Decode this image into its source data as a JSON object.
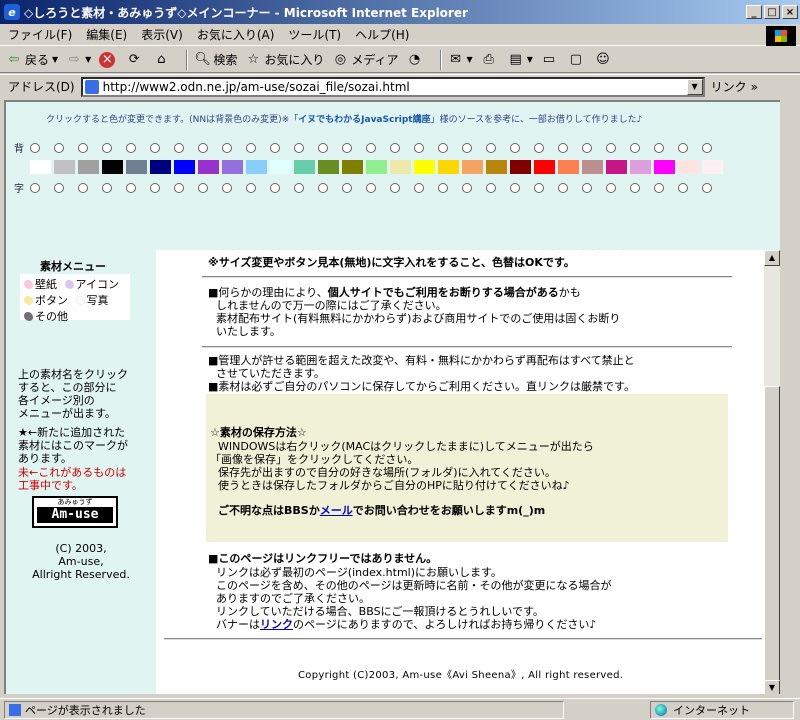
{
  "window": {
    "title": "◇しろうと素材・あみゅうず◇メインコーナー - Microsoft Internet Explorer"
  },
  "menu": [
    "ファイル(F)",
    "編集(E)",
    "表示(V)",
    "お気に入り(A)",
    "ツール(T)",
    "ヘルプ(H)"
  ],
  "toolbar": {
    "back": "戻る",
    "search": "検索",
    "favorites": "お気に入り",
    "media": "メディア"
  },
  "address": {
    "label": "アドレス(D)",
    "url": "http://www2.odn.ne.jp/am-use/sozai_file/sozai.html",
    "links": "リンク"
  },
  "top": {
    "note_prefix": "クリックすると色が変更できます。(NNは背景色のみ変更)※「",
    "note_link": "イヌでもわかるJavaScript講座",
    "note_suffix": "」様のソースを参考に、一部お借りして作りました♪",
    "bg_label": "背",
    "fg_label": "字",
    "swatches": [
      "#ffffff",
      "#c0c0c0",
      "#a0a0a0",
      "#000000",
      "#708090",
      "#000080",
      "#0000ff",
      "#9932cc",
      "#9370db",
      "#87cefa",
      "#e0ffff",
      "#66cdaa",
      "#6b8e23",
      "#808000",
      "#90ee90",
      "#eee8aa",
      "#ffff00",
      "#ffd700",
      "#f4a460",
      "#b8860b",
      "#800000",
      "#ff0000",
      "#ff7f50",
      "#bc8f8f",
      "#c71585",
      "#dda0dd",
      "#ff00ff",
      "#ffe4e1",
      "#fff0f5"
    ],
    "swatch_dot": "・"
  },
  "left": {
    "menu_title": "素材メニュー",
    "items": [
      {
        "label": "壁紙",
        "color": "#f8c8d8"
      },
      {
        "label": "アイコン",
        "color": "#d8c8f0"
      },
      {
        "label": "ボタン",
        "color": "#f8e8a0"
      },
      {
        "label": "写真",
        "color": "#ffffff"
      },
      {
        "label": "その他",
        "color": "#707070"
      }
    ],
    "help_lines": [
      "上の素材名をクリック",
      "すると、この部分に",
      "各イメージ別の",
      "メニューが出ます。"
    ],
    "new_lines": [
      "★←新たに追加された",
      "素材にはこのマークが",
      "あります。"
    ],
    "construction_lines": [
      "未←これがあるものは",
      "工事中です。"
    ],
    "logo_ruby": "あみゅうず",
    "logo_name": "Am-use",
    "copy_lines": [
      "(C) 2003,",
      "Am-use,",
      "Allright Reserved."
    ]
  },
  "main": {
    "cut_line": "※サイズ変更やボタン見本(無地)に文字入れをすること、色替はOKです。",
    "p1": [
      "■何らかの理由により、個人サイトでもご利用をお断りする場合があるかも",
      "しれませんので万一の際にはご了承ください。",
      "素材配布サイト(有料無料にかかわらず)および商用サイトでのご使用は固くお断り",
      "いたします。"
    ],
    "p2": [
      "■管理人が許せる範囲を超えた改変や、有料・無料にかかわらず再配布はすべて禁止と",
      "させていただきます。",
      "■素材は必ずご自分のパソコンに保存してからご利用ください。直リンクは厳禁です。"
    ],
    "save_title": "☆素材の保存方法☆",
    "save_lines": [
      "WINDOWSは右クリック(MACはクリックしたままに)してメニューが出たら",
      "「画像を保存」をクリックしてください。",
      "保存先が出ますので自分の好きな場所(フォルダ)に入れてください。",
      "使うときは保存したフォルダからご自分のHPに貼り付けてくださいね♪"
    ],
    "contact_pre": "ご不明な点はBBSか",
    "contact_link": "メール",
    "contact_post": "でお問い合わせをお願いしますm(_)m",
    "lf_title": "■このページはリンクフリーではありません。",
    "lf_lines": [
      "リンクは必ず最初のページ(index.html)にお願いします。",
      "このページを含め、その他のページは更新時に名前・その他が変更になる場合が",
      "ありますのでご了承ください。",
      "リンクしていただける場合、BBSにご一報頂けるとうれしいです。"
    ],
    "banner_pre": "バナーは",
    "banner_link": "リンク",
    "banner_post": "のページにありますので、よろしければお持ち帰りください♪",
    "copyright": "Copyright (C)2003, Am-use《Avi Sheena》, All right reserved."
  },
  "status": {
    "left": "ページが表示されました",
    "zone": "インターネット"
  }
}
